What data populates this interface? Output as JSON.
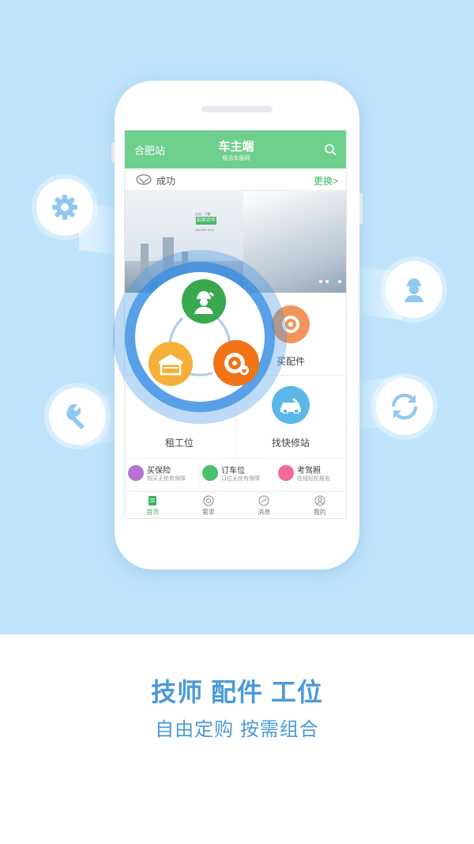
{
  "app": {
    "header": {
      "city": "合肥站",
      "title": "车主端",
      "subtitle": "极迅车服网"
    },
    "brand": {
      "name": "成功",
      "switch_label": "更换>"
    },
    "banner": {
      "badge": "招商合作",
      "line1": "点击 · 了解",
      "line2": "400 801 0123",
      "pages": 4,
      "active_page": 3
    },
    "grid": [
      {
        "label": "买配件"
      },
      {
        "label": "租工位"
      },
      {
        "label": "找快修站"
      }
    ],
    "services": [
      {
        "title": "买保险",
        "subtitle": "购买无忧有保障",
        "color": "#b673d1"
      },
      {
        "title": "订车位",
        "subtitle": "订位无忧有保障",
        "color": "#4cbf6b"
      },
      {
        "title": "考驾照",
        "subtitle": "在线轻松报名",
        "color": "#f06b9a"
      }
    ],
    "tabs": [
      {
        "label": "首页",
        "icon": "home-doc-icon",
        "active": true
      },
      {
        "label": "需求",
        "icon": "demand-icon",
        "active": false
      },
      {
        "label": "消息",
        "icon": "message-icon",
        "active": false
      },
      {
        "label": "我的",
        "icon": "profile-icon",
        "active": false
      }
    ]
  },
  "hub": {
    "icons": [
      "mechanic-icon",
      "garage-icon",
      "wheel-icon"
    ]
  },
  "floating_icons": [
    "gear-icon",
    "wrench-icon",
    "worker-icon",
    "refresh-icon"
  ],
  "tagline": {
    "title": "技师 配件 工位",
    "subtitle": "自由定购 按需组合"
  },
  "colors": {
    "accent_green": "#6fd08d",
    "blue": "#4a9ad8",
    "bg_blue": "#bfe3fb"
  }
}
